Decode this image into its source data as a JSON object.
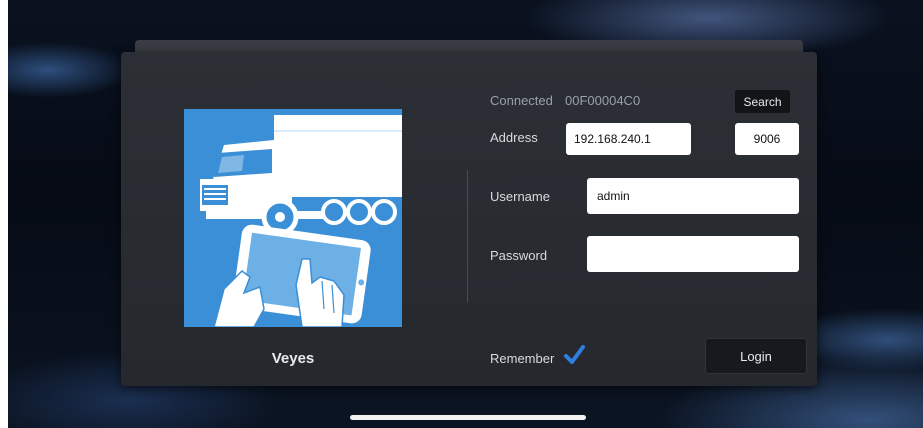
{
  "app": {
    "name": "Veyes",
    "logo_icon": "truck-tablet-logo-icon"
  },
  "connection": {
    "status_label": "Connected",
    "device_id": "00F00004C0",
    "search_label": "Search"
  },
  "form": {
    "address_label": "Address",
    "address_value": "192.168.240.1",
    "port_value": "9006",
    "username_label": "Username",
    "username_value": "admin",
    "password_label": "Password",
    "password_value": "",
    "remember_label": "Remember",
    "remember_checked": true,
    "login_label": "Login"
  },
  "colors": {
    "logo_blue": "#3a8fd6",
    "dialog_bg": "#2c2f35",
    "check_blue": "#2e7fe0"
  }
}
